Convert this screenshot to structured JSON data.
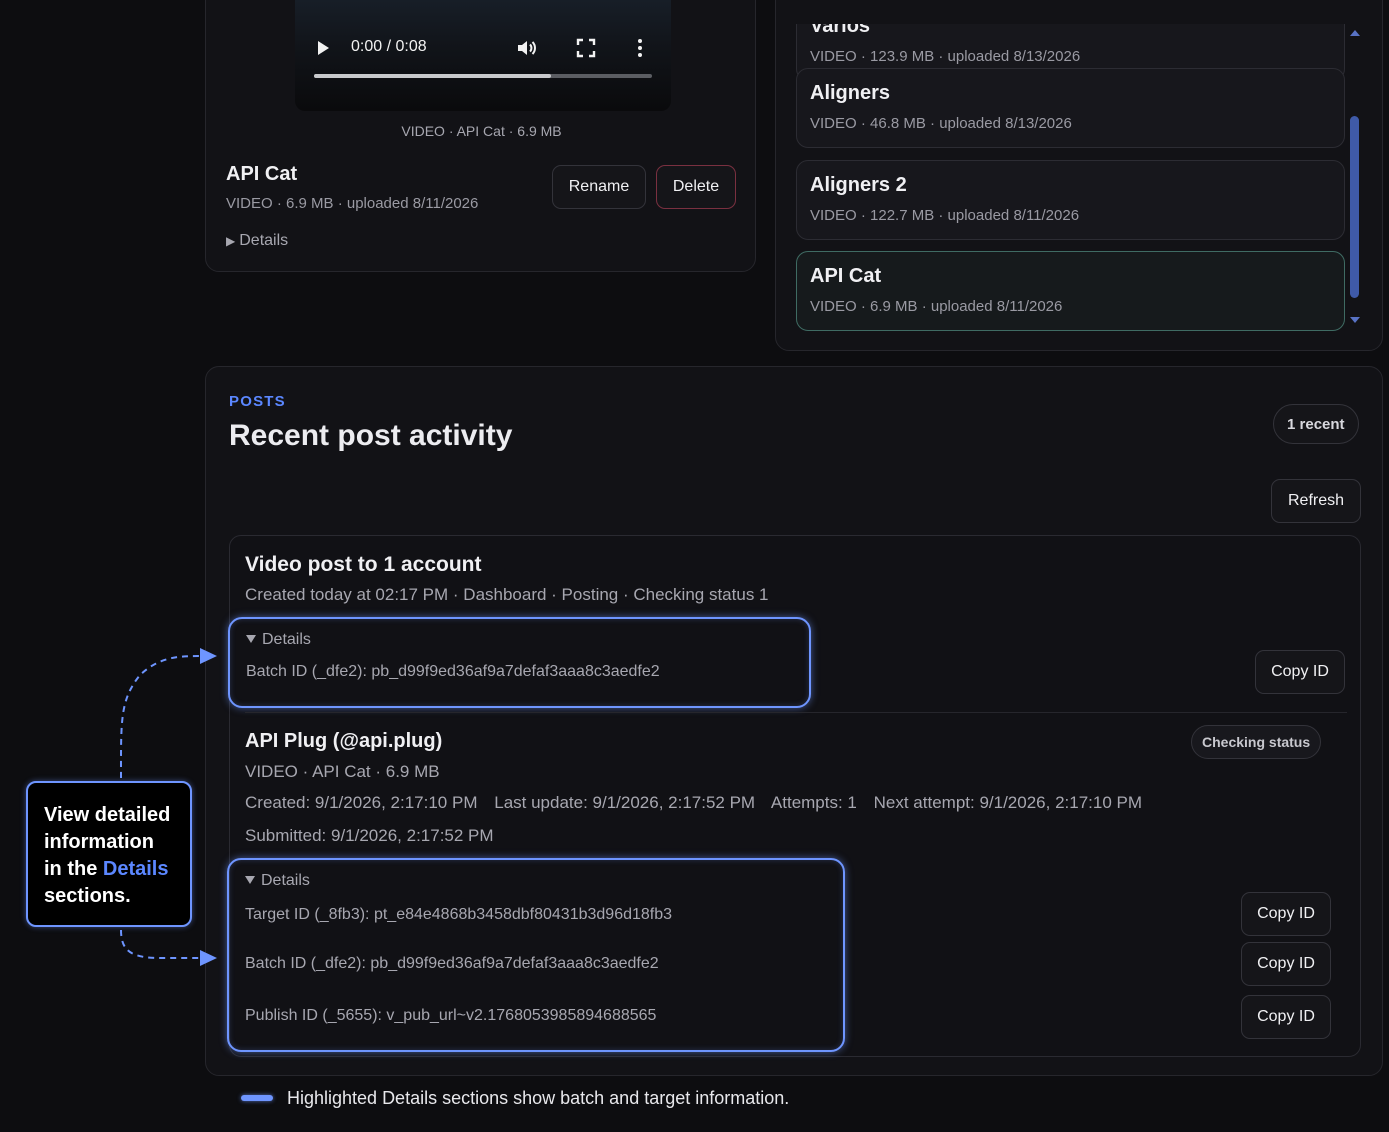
{
  "media": {
    "time_display": "0:00 / 0:08",
    "progress_fraction": 0.7,
    "caption": "VIDEO · API Cat · 6.9 MB",
    "title": "API Cat",
    "meta": "VIDEO · 6.9 MB · uploaded 8/11/2026",
    "details_label": "Details",
    "rename_label": "Rename",
    "delete_label": "Delete"
  },
  "library": {
    "items": [
      {
        "name": "Varios",
        "meta": "VIDEO · 123.9 MB · uploaded 8/13/2026"
      },
      {
        "name": "Aligners",
        "meta": "VIDEO · 46.8 MB · uploaded 8/13/2026"
      },
      {
        "name": "Aligners 2",
        "meta": "VIDEO · 122.7 MB · uploaded 8/11/2026"
      },
      {
        "name": "API Cat",
        "meta": "VIDEO · 6.9 MB · uploaded 8/11/2026"
      }
    ]
  },
  "posts": {
    "eyebrow": "POSTS",
    "heading": "Recent post activity",
    "recent_badge": "1 recent",
    "refresh_label": "Refresh",
    "batch": {
      "title": "Video post to 1 account",
      "subtitle": "Created today at 02:17 PM · Dashboard · Posting · Checking status 1",
      "details_label": "Details",
      "batch_id_line": "Batch ID (_dfe2): pb_d99f9ed36af9a7defaf3aaa8c3aedfe2",
      "copy_label": "Copy ID"
    },
    "target": {
      "title": "API Plug (@api.plug)",
      "status": "Checking status",
      "meta": "VIDEO · API Cat · 6.9 MB",
      "created": "Created: 9/1/2026, 2:17:10 PM",
      "last_update": "Last update: 9/1/2026, 2:17:52 PM",
      "attempts": "Attempts: 1",
      "next_attempt": "Next attempt: 9/1/2026, 2:17:10 PM",
      "submitted": "Submitted: 9/1/2026, 2:17:52 PM",
      "details_label": "Details",
      "target_id_line": "Target ID (_8fb3): pt_e84e4868b3458dbf80431b3d96d18fb3",
      "batch_id_line": "Batch ID (_dfe2): pb_d99f9ed36af9a7defaf3aaa8c3aedfe2",
      "publish_id_line": "Publish ID (_5655): v_pub_url~v2.1768053985894688565",
      "copy_label": "Copy ID"
    }
  },
  "callout": {
    "line1": "View detailed",
    "line2": "information",
    "line3_prefix": "in the ",
    "line3_highlight": "Details",
    "line4": "sections."
  },
  "legend": {
    "text": "Highlighted Details sections show batch and target information."
  },
  "colors": {
    "accent": "#6e95ff",
    "eyebrow": "#5b87ff",
    "background": "#0d0d10",
    "card": "#121216",
    "delete_border": "#7a3040"
  },
  "icons": [
    "play-icon",
    "volume-icon",
    "fullscreen-icon",
    "more-vertical-icon",
    "caret-right-icon",
    "caret-down-icon",
    "scroll-up-icon",
    "scroll-down-icon"
  ]
}
